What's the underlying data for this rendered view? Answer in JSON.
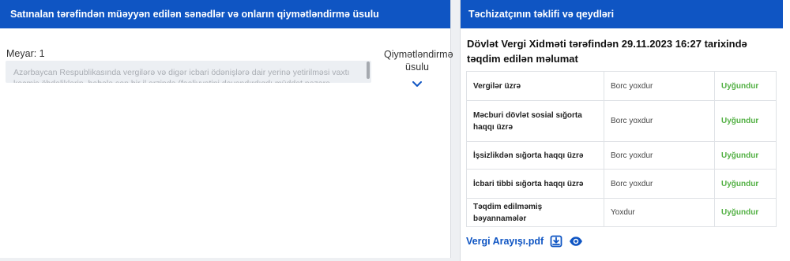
{
  "left_panel": {
    "header": "Satınalan tərəfindən müəyyən edilən sənədlər və onların qiymətləndirmə üsulu",
    "criteria_label": "Meyar: 1",
    "criteria_text": "Azərbaycan Respublikasında vergilərə və digər icbari ödənişlərə dair yerinə yetirilməsi vaxtı keçmiş öhdəliklərin, habelə son bir il ərzində (fəaliyyətini dayandırdıqdı müddət nəzərə alınmadan) vergidövlətinin",
    "eval_label": "Qiymətləndirmə üsulu"
  },
  "right_panel": {
    "header": "Təchizatçının təklifi və qeydləri",
    "info_title": "Dövlət Vergi Xidməti tərəfindən 29.11.2023 16:27 tarixində təqdim edilən məlumat",
    "rows": [
      {
        "label": "Vergilər üzrə",
        "status": "Borc yoxdur",
        "result": "Uyğundur"
      },
      {
        "label": "Məcburi dövlət sosial sığorta haqqı üzrə",
        "status": "Borc yoxdur",
        "result": "Uyğundur"
      },
      {
        "label": "İşsizlikdən sığorta haqqı üzrə",
        "status": "Borc yoxdur",
        "result": "Uyğundur"
      },
      {
        "label": "İcbari tibbi sığorta haqqı üzrə",
        "status": "Borc yoxdur",
        "result": "Uyğundur"
      },
      {
        "label": "Təqdim edilməmiş bəyannamələr",
        "status": "Yoxdur",
        "result": "Uyğundur"
      }
    ],
    "file_name": "Vergi Arayışı.pdf"
  },
  "icons": {
    "eval_toggle": "chevron-down-icon",
    "download": "download-icon",
    "view": "eye-icon"
  },
  "colors": {
    "header_blue": "#0f55c3",
    "ok_green": "#52b043"
  }
}
